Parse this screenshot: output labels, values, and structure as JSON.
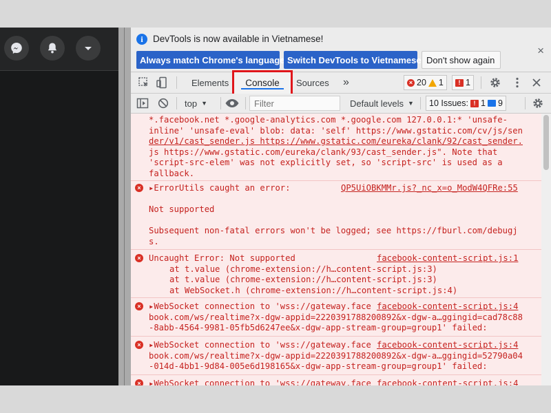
{
  "infobar": {
    "text": "DevTools is now available in Vietnamese!",
    "btn_match": "Always match Chrome's language",
    "btn_switch": "Switch DevTools to Vietnamese",
    "btn_dont": "Don't show again",
    "close": "×"
  },
  "tabs": {
    "elements": "Elements",
    "console": "Console",
    "sources": "Sources",
    "more": "»",
    "errors": "20",
    "warnings": "1",
    "issues_err": "1"
  },
  "toolbar": {
    "context": "top",
    "filter_placeholder": "Filter",
    "levels": "Default levels",
    "issues_label": "10 Issues:",
    "issues_err": "1",
    "issues_info": "9"
  },
  "console": {
    "e0": {
      "lines": [
        "*.facebook.net *.google-analytics.com *.google.com 127.0.0.1:* 'unsafe-",
        "inline' 'unsafe-eval' blob: data: 'self' https://www.gstatic.com/cv/js/sen",
        "der/v1/cast_sender.js https://www.gstatic.com/eureka/clank/92/cast_sender.",
        "js https://www.gstatic.com/eureka/clank/93/cast_sender.js\". Note that",
        "'script-src-elem' was not explicitly set, so 'script-src' is used as a",
        "fallback."
      ]
    },
    "e1": {
      "title": "ErrorUtils caught an error:",
      "source": "QP5UiOBKMMr.js?_nc_x=o_ModW4QFRe:55",
      "line2": "Not supported",
      "line3": "Subsequent non-fatal errors won't be logged; see https://fburl.com/debugj",
      "line4": "s."
    },
    "e2": {
      "title": "Uncaught Error: Not supported",
      "source": "facebook-content-script.js:1",
      "s1": "at t.value (chrome-extension://h…content-script.js:3)",
      "s2": "at t.value (chrome-extension://h…content-script.js:3)",
      "s3": "at WebSocket.h (chrome-extension://h…content-script.js:4)"
    },
    "e3": {
      "title": "WebSocket connection to 'wss://gateway.face",
      "source": "facebook-content-script.js:4",
      "l2": "book.com/ws/realtime?x-dgw-appid=2220391788200892&x-dgw-a…ggingid=cad78c88",
      "l3": "-8abb-4564-9981-05fb5d6247ee&x-dgw-app-stream-group=group1' failed:"
    },
    "e4": {
      "title": "WebSocket connection to 'wss://gateway.face",
      "source": "facebook-content-script.js:4",
      "l2": "book.com/ws/realtime?x-dgw-appid=2220391788200892&x-dgw-a…ggingid=52790a04",
      "l3": "-014d-4bb1-9d84-005e6d198165&x-dgw-app-stream-group=group1' failed:"
    },
    "e5": {
      "title": "WebSocket connection to 'wss://gateway.face",
      "source": "facebook-content-script.js:4"
    }
  },
  "icons": {
    "messenger": "messenger-icon",
    "bell": "bell-icon",
    "chevron": "chevron-down-icon"
  },
  "colors": {
    "error_text": "#c5221f",
    "error_bg": "#fcebeb",
    "accent_blue": "#2b63c8",
    "highlight_red": "#e0161b"
  }
}
